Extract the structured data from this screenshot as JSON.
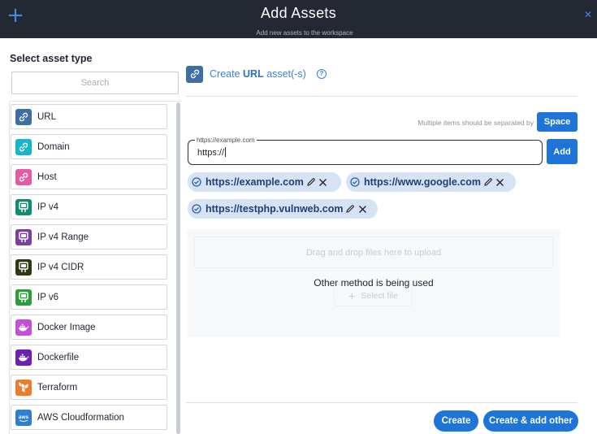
{
  "header": {
    "title": "Add Assets",
    "subtitle": "Add new assets to the workspace",
    "plus_icon": "plus-icon",
    "close_icon": "close-icon",
    "plus_glyph": "+",
    "close_glyph": "✕"
  },
  "sidebar": {
    "title": "Select asset type",
    "search_placeholder": "Search",
    "items": [
      {
        "label": "URL",
        "icon": "link-icon",
        "color": "#3d6ea5"
      },
      {
        "label": "Domain",
        "icon": "link-icon",
        "color": "#17b5c9"
      },
      {
        "label": "Host",
        "icon": "link-icon",
        "color": "#e45aa4"
      },
      {
        "label": "IP v4",
        "icon": "network-icon",
        "color": "#138a72"
      },
      {
        "label": "IP v4 Range",
        "icon": "network-icon",
        "color": "#7b3fa1"
      },
      {
        "label": "IP v4 CIDR",
        "icon": "network-icon",
        "color": "#2d3a12"
      },
      {
        "label": "IP v6",
        "icon": "network-icon",
        "color": "#2f9c3a"
      },
      {
        "label": "Docker Image",
        "icon": "docker-icon",
        "color": "#c24fd6"
      },
      {
        "label": "Dockerfile",
        "icon": "docker-icon",
        "color": "#6d1fb8"
      },
      {
        "label": "Terraform",
        "icon": "terraform-icon",
        "color": "#ef7a2a"
      },
      {
        "label": "AWS Cloudformation",
        "icon": "aws-icon",
        "color": "#2f7fd1"
      }
    ]
  },
  "main": {
    "create_prefix": "Create",
    "create_type": "URL",
    "create_suffix": "asset(-s)",
    "help_glyph": "?",
    "separator_note": "Multiple items should be separated by",
    "space_button": "Space",
    "url_field": {
      "floating_label": "https://example.com",
      "value": "https://"
    },
    "add_button": "Add",
    "chips": [
      "https://example.com",
      "https://www.google.com",
      "https://testphp.vulnweb.com"
    ],
    "upload": {
      "drop_text": "Drag and drop files here to upload",
      "select_file": "Select file",
      "select_plus": "+",
      "overlay_text": "Other method is being used"
    },
    "buttons": {
      "create": "Create",
      "create_add": "Create & add other"
    }
  },
  "colors": {
    "accent": "#1e74d8",
    "header_bg": "#232833",
    "chip_bg": "#d5e3f5"
  }
}
